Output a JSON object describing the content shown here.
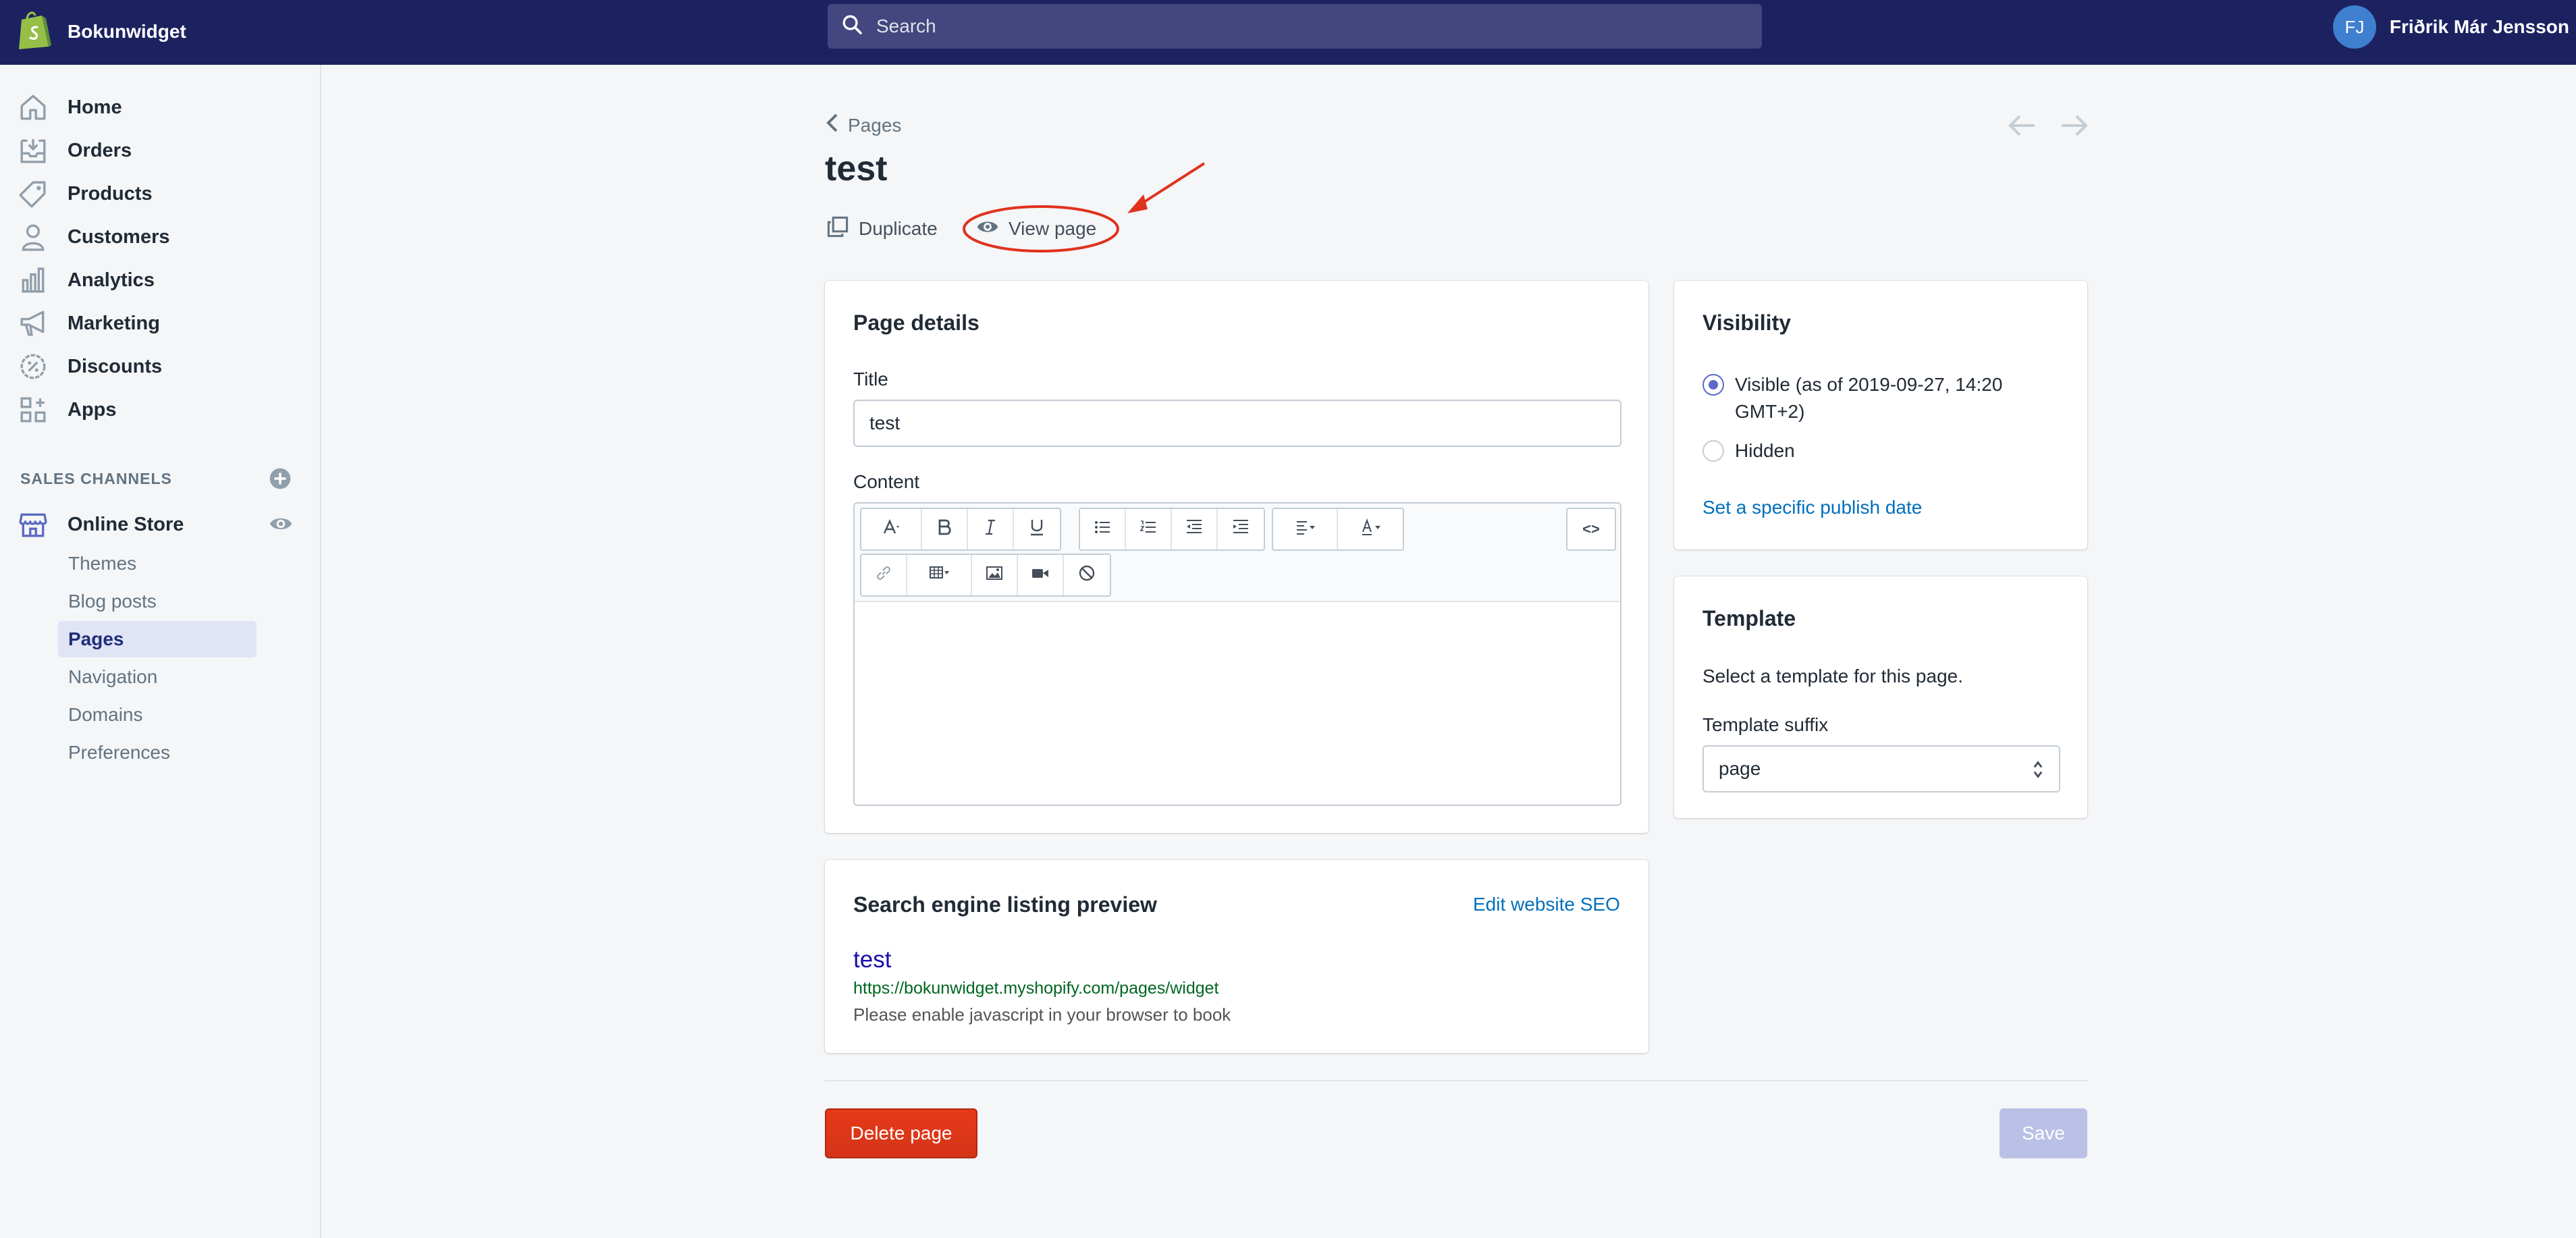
{
  "app": {
    "store_name": "Bokunwidget",
    "search_placeholder": "Search",
    "user_initials": "FJ",
    "user_name": "Friðrik Már Jensson"
  },
  "sidebar": {
    "items": [
      {
        "label": "Home",
        "icon": "home-icon"
      },
      {
        "label": "Orders",
        "icon": "orders-icon"
      },
      {
        "label": "Products",
        "icon": "tag-icon"
      },
      {
        "label": "Customers",
        "icon": "person-icon"
      },
      {
        "label": "Analytics",
        "icon": "bar-chart-icon"
      },
      {
        "label": "Marketing",
        "icon": "megaphone-icon"
      },
      {
        "label": "Discounts",
        "icon": "discount-icon"
      },
      {
        "label": "Apps",
        "icon": "apps-icon"
      }
    ],
    "section_title": "SALES CHANNELS",
    "channel": "Online Store",
    "sub_items": [
      "Themes",
      "Blog posts",
      "Pages",
      "Navigation",
      "Domains",
      "Preferences"
    ],
    "active_sub_item": "Pages"
  },
  "page": {
    "breadcrumb": "Pages",
    "title": "test",
    "actions": {
      "duplicate": "Duplicate",
      "view": "View page"
    }
  },
  "details": {
    "card_title": "Page details",
    "title_label": "Title",
    "title_value": "test",
    "content_label": "Content",
    "toolbar": {
      "code_label": "<>"
    }
  },
  "visibility": {
    "card_title": "Visibility",
    "visible_label_line1": "Visible (as of 2019-09-27, 14:20",
    "visible_label_line2": "GMT+2)",
    "hidden_label": "Hidden",
    "selected": "visible",
    "publish_link": "Set a specific publish date"
  },
  "template": {
    "card_title": "Template",
    "description": "Select a template for this page.",
    "suffix_label": "Template suffix",
    "suffix_value": "page"
  },
  "seo": {
    "card_title": "Search engine listing preview",
    "edit_link": "Edit website SEO",
    "preview_title": "test",
    "preview_url": "https://bokunwidget.myshopify.com/pages/widget",
    "preview_description": "Please enable javascript in your browser to book"
  },
  "footer": {
    "delete_label": "Delete page",
    "save_label": "Save"
  },
  "colors": {
    "topbar": "#1c2260",
    "accent": "#5c6ac4",
    "link": "#006fbb",
    "danger": "#d53417",
    "annotation": "#e0321d"
  }
}
